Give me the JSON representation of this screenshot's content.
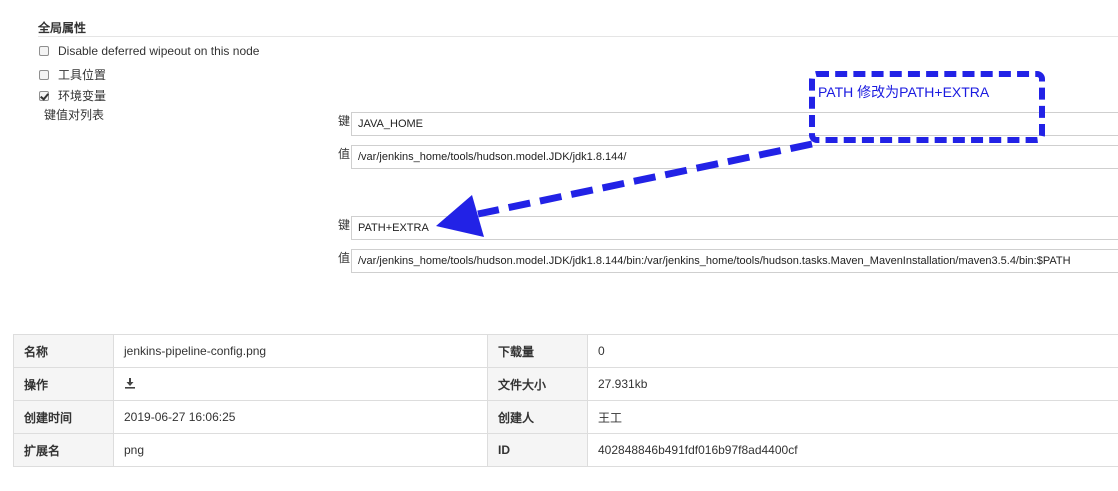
{
  "config": {
    "section_title": "全局属性",
    "checkboxes": [
      {
        "label": "Disable deferred wipeout on this node",
        "checked": false
      },
      {
        "label": "工具位置",
        "checked": false
      },
      {
        "label": "环境变量",
        "checked": true
      }
    ],
    "kv_caption": "键值对列表",
    "key_label": "键",
    "value_label": "值",
    "pairs": [
      {
        "key": "JAVA_HOME",
        "value": "/var/jenkins_home/tools/hudson.model.JDK/jdk1.8.144/"
      },
      {
        "key": "PATH+EXTRA",
        "value": "/var/jenkins_home/tools/hudson.model.JDK/jdk1.8.144/bin:/var/jenkins_home/tools/hudson.tasks.Maven_MavenInstallation/maven3.5.4/bin:$PATH"
      }
    ]
  },
  "annotation": {
    "text": "PATH 修改为PATH+EXTRA",
    "color": "#2222e6"
  },
  "file_info": {
    "rows": [
      {
        "k1": "名称",
        "v1": "jenkins-pipeline-config.png",
        "k2": "下载量",
        "v2": "0"
      },
      {
        "k1": "操作",
        "v1_icon": "download-icon",
        "k2": "文件大小",
        "v2": "27.931kb"
      },
      {
        "k1": "创建时间",
        "v1": "2019-06-27 16:06:25",
        "k2": "创建人",
        "v2": "王工"
      },
      {
        "k1": "扩展名",
        "v1": "png",
        "k2": "ID",
        "v2": "402848846b491fdf016b97f8ad4400cf"
      }
    ]
  }
}
